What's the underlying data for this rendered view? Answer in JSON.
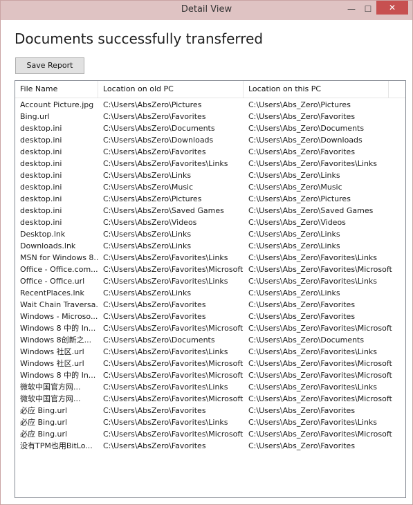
{
  "window": {
    "title": "Detail View",
    "minimize_glyph": "—",
    "maximize_glyph": "☐",
    "close_glyph": "✕"
  },
  "main": {
    "heading": "Documents successfully transferred",
    "save_label": "Save Report"
  },
  "table": {
    "columns": [
      "File Name",
      "Location on old PC",
      "Location on this PC"
    ],
    "rows": [
      [
        "Account Picture.jpg",
        "C:\\Users\\AbsZero\\Pictures",
        "C:\\Users\\Abs_Zero\\Pictures"
      ],
      [
        "Bing.url",
        "C:\\Users\\AbsZero\\Favorites",
        "C:\\Users\\Abs_Zero\\Favorites"
      ],
      [
        "desktop.ini",
        "C:\\Users\\AbsZero\\Documents",
        "C:\\Users\\Abs_Zero\\Documents"
      ],
      [
        "desktop.ini",
        "C:\\Users\\AbsZero\\Downloads",
        "C:\\Users\\Abs_Zero\\Downloads"
      ],
      [
        "desktop.ini",
        "C:\\Users\\AbsZero\\Favorites",
        "C:\\Users\\Abs_Zero\\Favorites"
      ],
      [
        "desktop.ini",
        "C:\\Users\\AbsZero\\Favorites\\Links",
        "C:\\Users\\Abs_Zero\\Favorites\\Links"
      ],
      [
        "desktop.ini",
        "C:\\Users\\AbsZero\\Links",
        "C:\\Users\\Abs_Zero\\Links"
      ],
      [
        "desktop.ini",
        "C:\\Users\\AbsZero\\Music",
        "C:\\Users\\Abs_Zero\\Music"
      ],
      [
        "desktop.ini",
        "C:\\Users\\AbsZero\\Pictures",
        "C:\\Users\\Abs_Zero\\Pictures"
      ],
      [
        "desktop.ini",
        "C:\\Users\\AbsZero\\Saved Games",
        "C:\\Users\\Abs_Zero\\Saved Games"
      ],
      [
        "desktop.ini",
        "C:\\Users\\AbsZero\\Videos",
        "C:\\Users\\Abs_Zero\\Videos"
      ],
      [
        "Desktop.lnk",
        "C:\\Users\\AbsZero\\Links",
        "C:\\Users\\Abs_Zero\\Links"
      ],
      [
        "Downloads.lnk",
        "C:\\Users\\AbsZero\\Links",
        "C:\\Users\\Abs_Zero\\Links"
      ],
      [
        "MSN for Windows 8...",
        "C:\\Users\\AbsZero\\Favorites\\Links",
        "C:\\Users\\Abs_Zero\\Favorites\\Links"
      ],
      [
        "Office - Office.com....",
        "C:\\Users\\AbsZero\\Favorites\\Microsoft",
        "C:\\Users\\Abs_Zero\\Favorites\\Microsoft"
      ],
      [
        "Office - Office.url",
        "C:\\Users\\AbsZero\\Favorites\\Links",
        "C:\\Users\\Abs_Zero\\Favorites\\Links"
      ],
      [
        "RecentPlaces.lnk",
        "C:\\Users\\AbsZero\\Links",
        "C:\\Users\\Abs_Zero\\Links"
      ],
      [
        "Wait Chain Traversa...",
        "C:\\Users\\AbsZero\\Favorites",
        "C:\\Users\\Abs_Zero\\Favorites"
      ],
      [
        "Windows - Microso...",
        "C:\\Users\\AbsZero\\Favorites",
        "C:\\Users\\Abs_Zero\\Favorites"
      ],
      [
        "Windows 8 中的 In...",
        "C:\\Users\\AbsZero\\Favorites\\Microsoft",
        "C:\\Users\\Abs_Zero\\Favorites\\Microsoft"
      ],
      [
        "Windows 8创新之...",
        "C:\\Users\\AbsZero\\Documents",
        "C:\\Users\\Abs_Zero\\Documents"
      ],
      [
        "Windows 社区.url",
        "C:\\Users\\AbsZero\\Favorites\\Links",
        "C:\\Users\\Abs_Zero\\Favorites\\Links"
      ],
      [
        "Windows 社区.url",
        "C:\\Users\\AbsZero\\Favorites\\Microsoft",
        "C:\\Users\\Abs_Zero\\Favorites\\Microsoft"
      ],
      [
        "Windows 8 中的 In...",
        "C:\\Users\\AbsZero\\Favorites\\Microsoft",
        "C:\\Users\\Abs_Zero\\Favorites\\Microsoft"
      ],
      [
        "微软中国官方网...",
        "C:\\Users\\AbsZero\\Favorites\\Links",
        "C:\\Users\\Abs_Zero\\Favorites\\Links"
      ],
      [
        "微软中国官方网...",
        "C:\\Users\\AbsZero\\Favorites\\Microsoft",
        "C:\\Users\\Abs_Zero\\Favorites\\Microsoft"
      ],
      [
        "必应 Bing.url",
        "C:\\Users\\AbsZero\\Favorites",
        "C:\\Users\\Abs_Zero\\Favorites"
      ],
      [
        "必应 Bing.url",
        "C:\\Users\\AbsZero\\Favorites\\Links",
        "C:\\Users\\Abs_Zero\\Favorites\\Links"
      ],
      [
        "必应 Bing.url",
        "C:\\Users\\AbsZero\\Favorites\\Microsoft",
        "C:\\Users\\Abs_Zero\\Favorites\\Microsoft"
      ],
      [
        "没有TPM也用BitLo...",
        "C:\\Users\\AbsZero\\Favorites",
        "C:\\Users\\Abs_Zero\\Favorites"
      ]
    ]
  }
}
